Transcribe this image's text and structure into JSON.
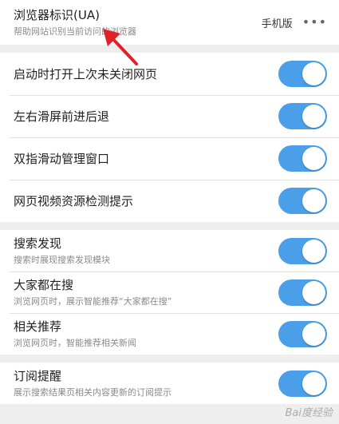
{
  "ua": {
    "title": "浏览器标识(UA)",
    "subtitle": "帮助网站识别当前访问的浏览器",
    "value": "手机版",
    "more_icon": "more-dots-icon"
  },
  "group1": [
    {
      "label": "启动时打开上次未关闭网页",
      "on": true
    },
    {
      "label": "左右滑屏前进后退",
      "on": true
    },
    {
      "label": "双指滑动管理窗口",
      "on": true
    },
    {
      "label": "网页视频资源检测提示",
      "on": true
    }
  ],
  "group2": [
    {
      "label": "搜索发现",
      "desc": "搜索时展现搜索发现模块",
      "on": true
    },
    {
      "label": "大家都在搜",
      "desc": "浏览网页时，展示智能推荐“大家都在搜”",
      "on": true
    },
    {
      "label": "相关推荐",
      "desc": "浏览网页时，智能推荐相关新闻",
      "on": true
    }
  ],
  "group3": [
    {
      "label": "订阅提醒",
      "desc": "展示搜索结果页相关内容更新的订阅提示",
      "on": true
    }
  ],
  "watermark": "Bai度经验",
  "colors": {
    "toggle_on": "#4a9fe8",
    "arrow": "#e0202a"
  }
}
